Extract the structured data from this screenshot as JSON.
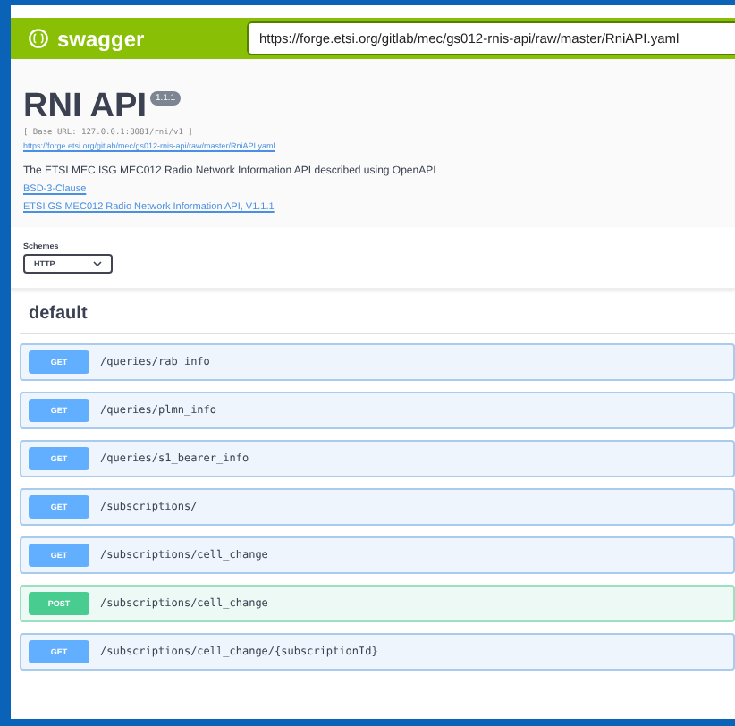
{
  "header": {
    "logo": "swagger",
    "url": "https://forge.etsi.org/gitlab/mec/gs012-rnis-api/raw/master/RniAPI.yaml"
  },
  "info": {
    "title": "RNI API",
    "version": "1.1.1",
    "base_url": "[ Base URL: 127.0.0.1:8081/rni/v1 ]",
    "spec_link": "https://forge.etsi.org/gitlab/mec/gs012-rnis-api/raw/master/RniAPI.yaml",
    "description": "The ETSI MEC ISG MEC012 Radio Network Information API described using OpenAPI",
    "license": "BSD-3-Clause",
    "external_doc": "ETSI GS MEC012 Radio Network Information API, V1.1.1"
  },
  "schemes": {
    "label": "Schemes",
    "value": "HTTP"
  },
  "section": "default",
  "operations": [
    {
      "method": "GET",
      "path": "/queries/rab_info"
    },
    {
      "method": "GET",
      "path": "/queries/plmn_info"
    },
    {
      "method": "GET",
      "path": "/queries/s1_bearer_info"
    },
    {
      "method": "GET",
      "path": "/subscriptions/"
    },
    {
      "method": "GET",
      "path": "/subscriptions/cell_change"
    },
    {
      "method": "POST",
      "path": "/subscriptions/cell_change"
    },
    {
      "method": "GET",
      "path": "/subscriptions/cell_change/{subscriptionId}"
    }
  ]
}
